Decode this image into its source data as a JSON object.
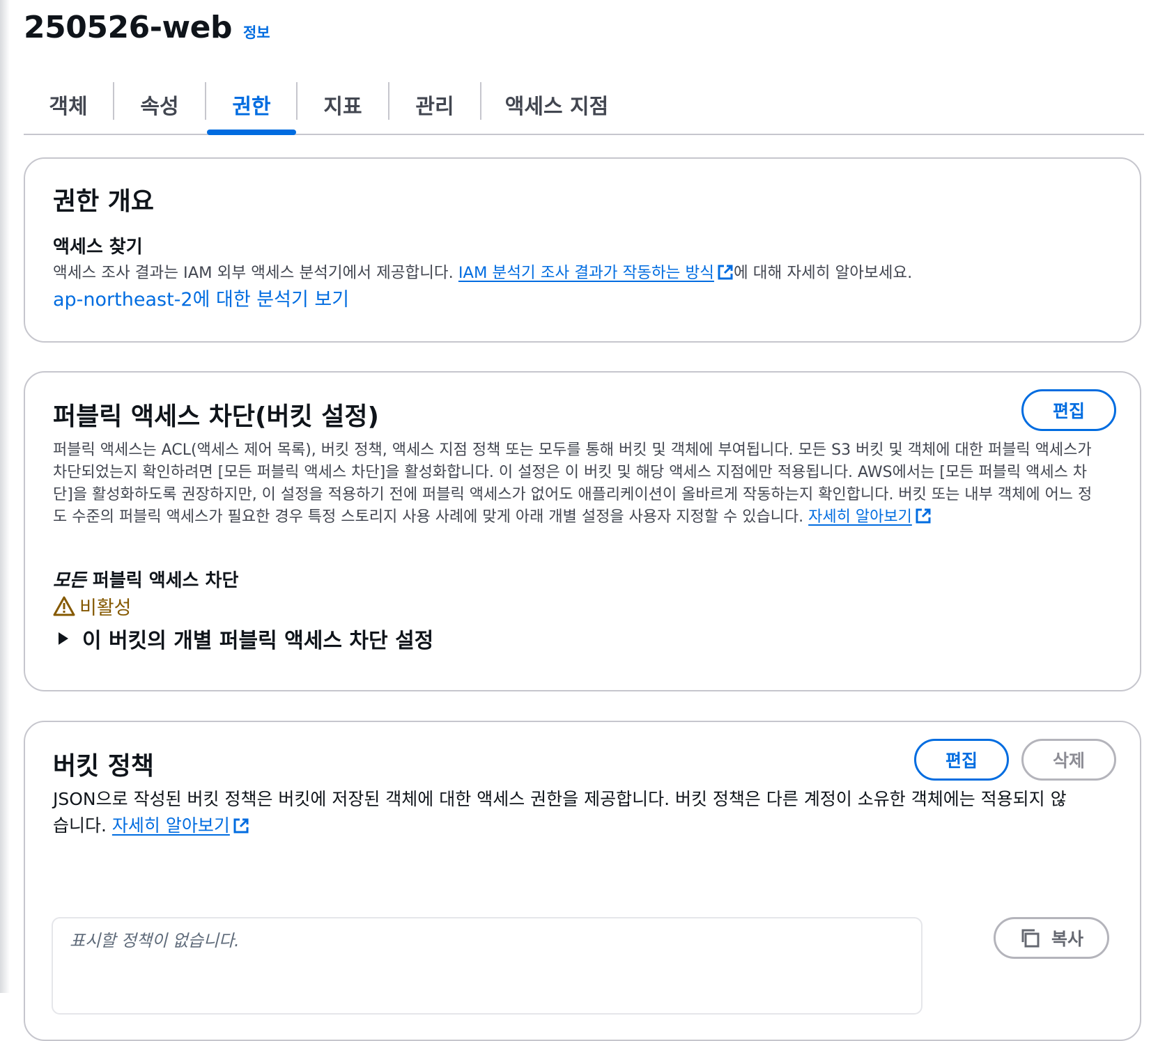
{
  "header": {
    "title": "250526-web",
    "info": "정보"
  },
  "tabs": [
    {
      "label": "객체",
      "active": false
    },
    {
      "label": "속성",
      "active": false
    },
    {
      "label": "권한",
      "active": true
    },
    {
      "label": "지표",
      "active": false
    },
    {
      "label": "관리",
      "active": false
    },
    {
      "label": "액세스 지점",
      "active": false
    }
  ],
  "overview": {
    "title": "권한 개요",
    "access_finder_title": "액세스 찾기",
    "desc_prefix": "액세스 조사 결과는 IAM 외부 액세스 분석기에서 제공합니다. ",
    "desc_link": "IAM 분석기 조사 결과가 작동하는 방식",
    "desc_suffix": "에 대해 자세히 알아보세요.",
    "region_link": "ap-northeast-2에 대한 분석기 보기"
  },
  "block_public": {
    "title": "퍼블릭 액세스 차단(버킷 설정)",
    "edit_label": "편집",
    "desc_line1": "퍼블릭 액세스는 ACL(액세스 제어 목록), 버킷 정책, 액세스 지점 정책 또는 모두를 통해 버킷 및 객체에 부여됩니다. 모든 S3 버킷 및 객체에 대한 퍼블릭 액세스가",
    "desc_line2": "차단되었는지 확인하려면 [모든 퍼블릭 액세스 차단]을 활성화합니다. 이 설정은 이 버킷 및 해당 액세스 지점에만 적용됩니다. AWS에서는 [모든 퍼블릭 액세스 차",
    "desc_line3": "단]을 활성화하도록 권장하지만, 이 설정을 적용하기 전에 퍼블릭 액세스가 없어도 애플리케이션이 올바르게 작동하는지 확인합니다. 버킷 또는 내부 객체에 어느 정",
    "desc_line4": "도 수준의 퍼블릭 액세스가 필요한 경우 특정 스토리지 사용 사례에 맞게 아래 개별 설정을 사용자 지정할 수 있습니다. ",
    "learn_more": "자세히 알아보기",
    "block_all_em": "모든",
    "block_all_rest": " 퍼블릭 액세스 차단",
    "status_label": "비활성",
    "status_color": "#855900",
    "expander_label": "이 버킷의 개별 퍼블릭 액세스 차단 설정"
  },
  "bucket_policy": {
    "title": "버킷 정책",
    "edit_label": "편집",
    "delete_label": "삭제",
    "desc_line1": "JSON으로 작성된 버킷 정책은 버킷에 저장된 객체에 대한 액세스 권한을 제공합니다. 버킷 정책은 다른 계정이 소유한 객체에는 적용되지 않",
    "desc_line2": "습니다. ",
    "learn_more": "자세히 알아보기",
    "empty_text": "표시할 정책이 없습니다.",
    "copy_label": "복사"
  },
  "icons": [
    "external-link-icon",
    "warning-icon",
    "caret-right-icon",
    "copy-icon"
  ],
  "colors": {
    "link": "#006ce0",
    "border": "#c6c6cd",
    "text": "#0f141a",
    "muted": "#424650"
  }
}
